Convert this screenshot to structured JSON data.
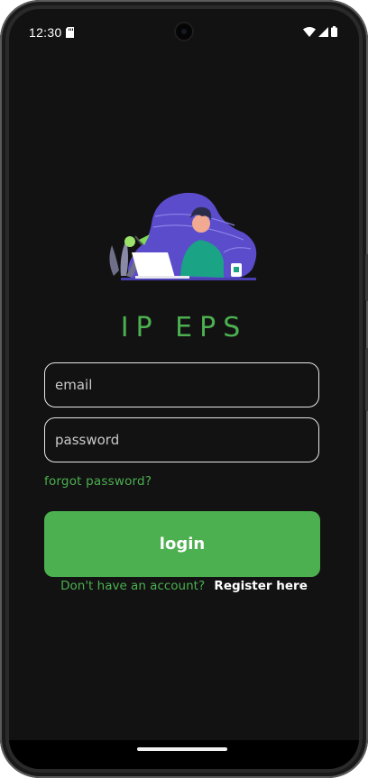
{
  "status_bar": {
    "time": "12:30"
  },
  "app": {
    "title": "IP EPS"
  },
  "form": {
    "email_placeholder": "email",
    "password_placeholder": "password",
    "forgot_label": "forgot password?",
    "login_label": "login",
    "register_prompt": "Don't have an account?",
    "register_link": "Register here"
  },
  "colors": {
    "accent": "#4caf50",
    "background": "#121212",
    "illustration": "#5b4ccc"
  },
  "icons": [
    "sd-card-icon",
    "wifi-icon",
    "signal-icon",
    "battery-icon",
    "person-laptop-illustration"
  ]
}
